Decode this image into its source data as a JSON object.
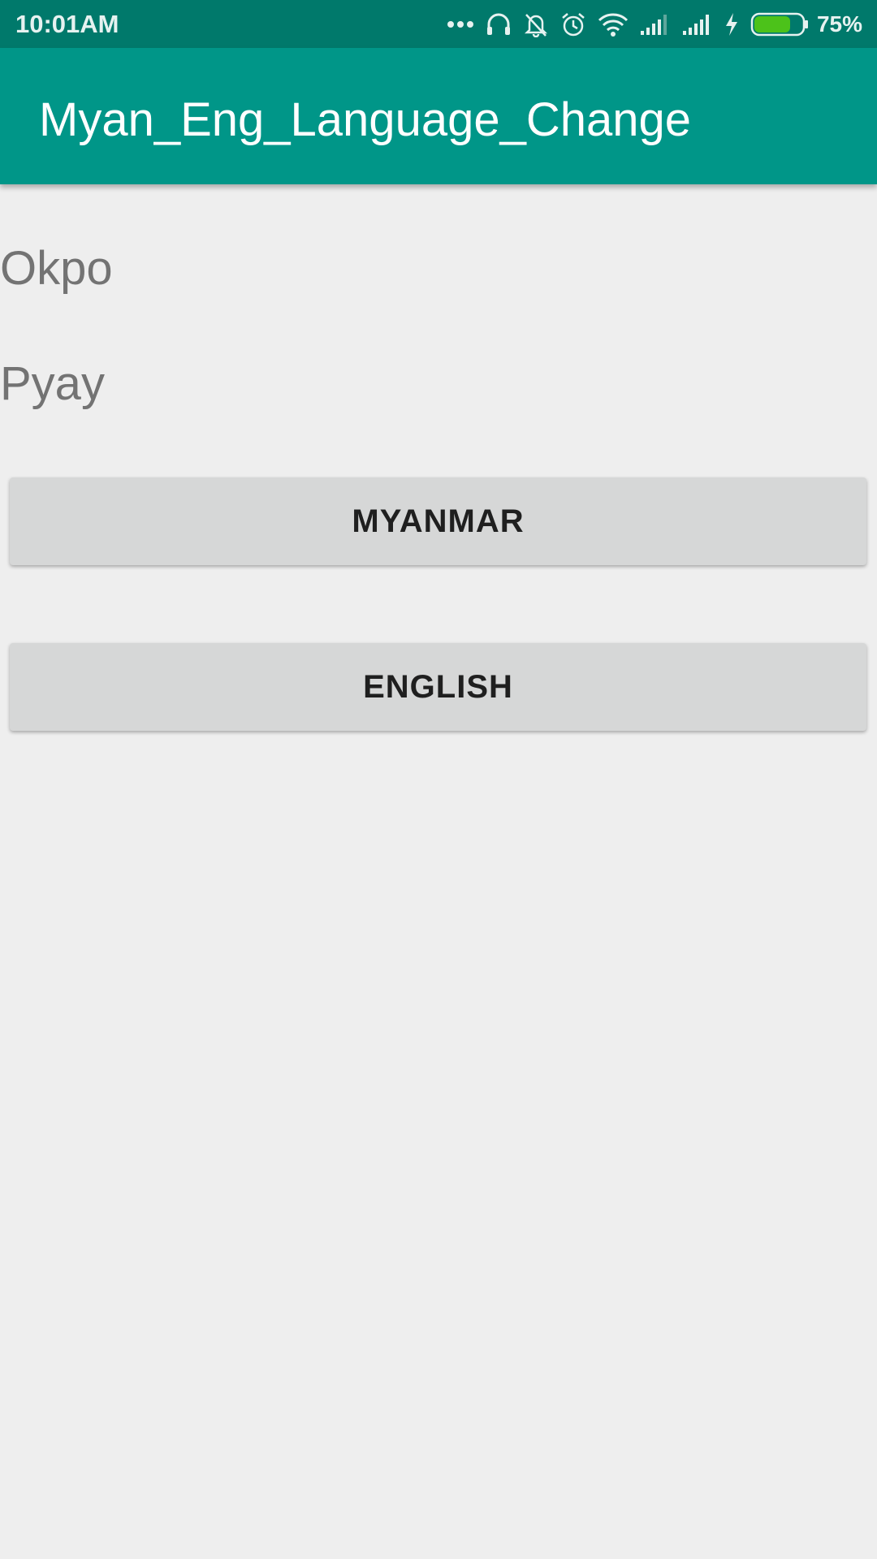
{
  "status_bar": {
    "time": "10:01AM",
    "battery_percent": "75%",
    "battery_level": 0.75,
    "battery_color": "#4cc21a",
    "icons": [
      "more-dots-icon",
      "headphones-icon",
      "bell-off-icon",
      "alarm-icon",
      "wifi-icon",
      "signal-icon",
      "signal-icon",
      "charging-icon",
      "battery-icon"
    ]
  },
  "app_bar": {
    "title": "Myan_Eng_Language_Change",
    "color": "#009688"
  },
  "content": {
    "text_1": "Okpo",
    "text_2": "Pyay"
  },
  "buttons": {
    "myanmar_label": "MYANMAR",
    "english_label": "ENGLISH"
  }
}
